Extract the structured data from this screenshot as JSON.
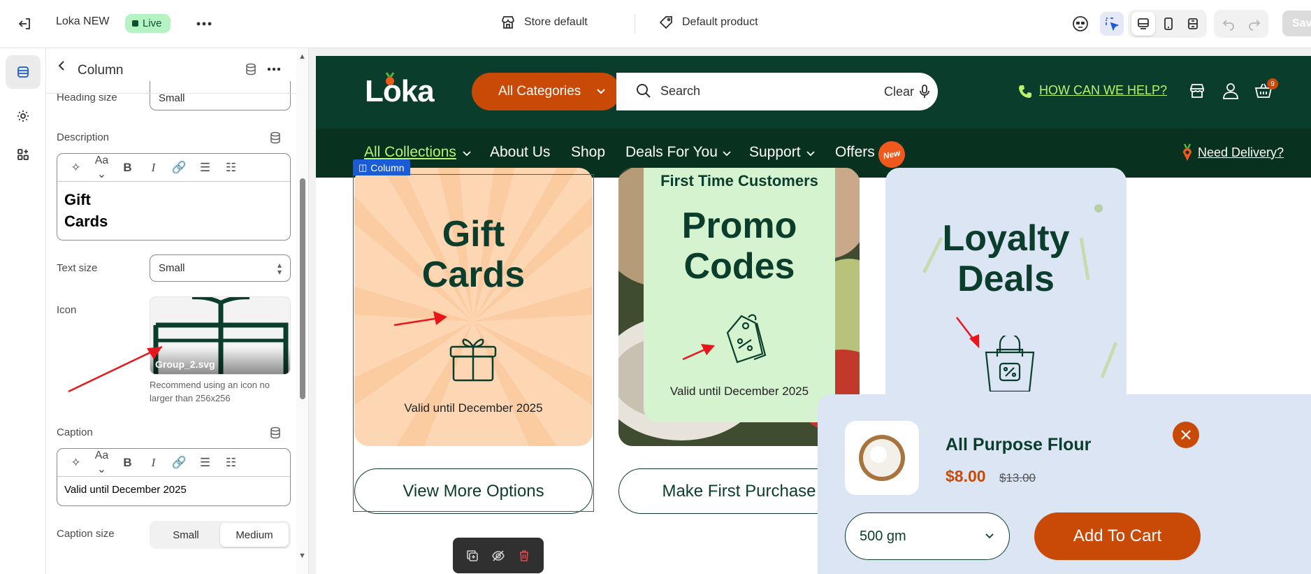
{
  "topbar": {
    "store_name": "Loka NEW",
    "live_badge": "Live",
    "store_selector": "Store default",
    "template_selector": "Default product",
    "save_label": "Save"
  },
  "panel": {
    "title": "Column",
    "heading_size_label": "Heading size",
    "heading_size_value": "Small",
    "description_label": "Description",
    "description_line1": "Gift",
    "description_line2": "Cards",
    "text_size_label": "Text size",
    "text_size_value": "Small",
    "icon_label": "Icon",
    "icon_filename": "Group_2.svg",
    "icon_hint": "Recommend using an icon no larger than 256x256",
    "caption_label": "Caption",
    "caption_value": "Valid until December 2025",
    "caption_size_label": "Caption size",
    "caption_size_options": [
      "Small",
      "Medium"
    ],
    "caption_size_selected": "Medium"
  },
  "store": {
    "logo": "Loka",
    "category_button": "All Categories",
    "search_placeholder": "Search",
    "clear_label": "Clear",
    "help_link": "HOW CAN WE HELP?",
    "cart_count": "9",
    "nav": [
      "All Collections",
      "About Us",
      "Shop",
      "Deals For You",
      "Support",
      "Offers"
    ],
    "new_badge": "New",
    "delivery_link": "Need Delivery?",
    "selected_block_label": "Column",
    "cards": [
      {
        "title_line1": "Gift",
        "title_line2": "Cards",
        "caption": "Valid until December 2025",
        "button": "View More Options"
      },
      {
        "subtitle": "First Time Customers",
        "title_line1": "Promo",
        "title_line2": "Codes",
        "caption": "Valid until December 2025",
        "button": "Make First Purchase"
      },
      {
        "title_line1": "Loyalty",
        "title_line2": "Deals"
      }
    ],
    "product_popup": {
      "name": "All Purpose Flour",
      "price": "$8.00",
      "compare_price": "$13.00",
      "variant": "500 gm",
      "add_to_cart": "Add To Cart"
    }
  },
  "colors": {
    "brand_dark": "#0b3d2c",
    "accent_orange": "#c94a06",
    "help_green": "#b7f36b",
    "selection_blue": "#1a5bd6"
  }
}
